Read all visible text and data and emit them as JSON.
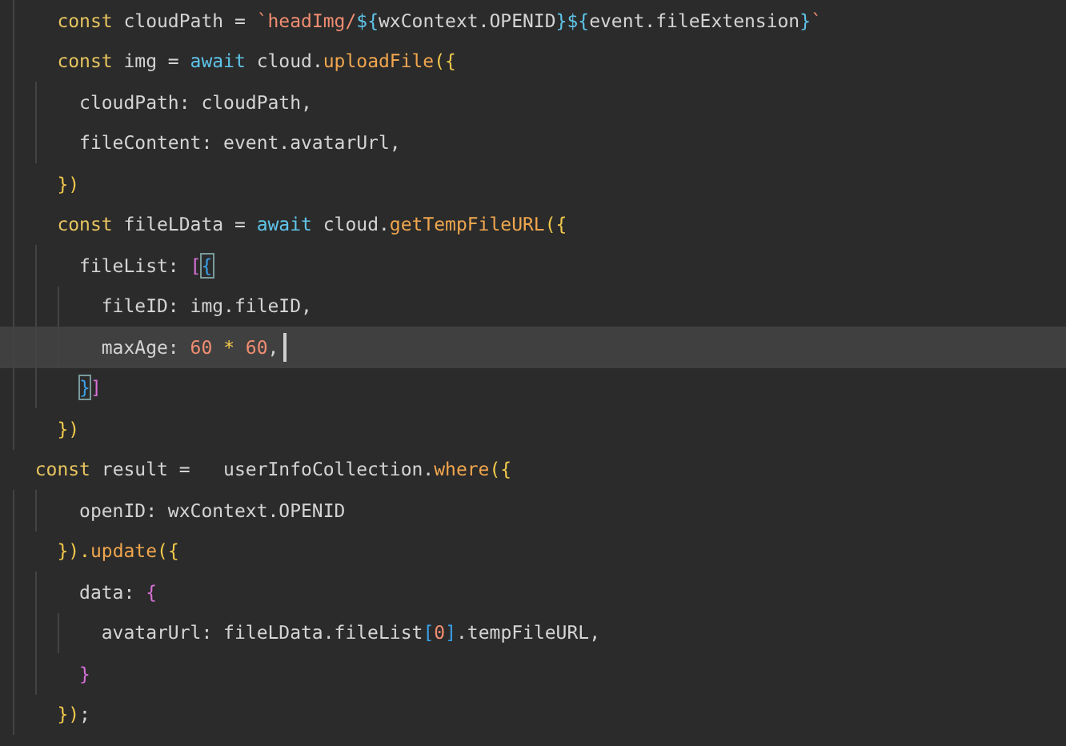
{
  "editor": {
    "lines": [
      {
        "current": false,
        "tokens": [
          {
            "text": "    const",
            "kind": "keyword"
          },
          {
            "text": " cloudPath = ",
            "kind": "plain"
          },
          {
            "text": "`headImg/",
            "kind": "string"
          },
          {
            "text": "${",
            "kind": "interp"
          },
          {
            "text": "wxContext.OPENID",
            "kind": "plain"
          },
          {
            "text": "}${",
            "kind": "interp"
          },
          {
            "text": "event.fileExtension",
            "kind": "plain"
          },
          {
            "text": "}",
            "kind": "interp"
          },
          {
            "text": "`",
            "kind": "string"
          }
        ]
      },
      {
        "current": false,
        "tokens": [
          {
            "text": "    const",
            "kind": "keyword"
          },
          {
            "text": " img = ",
            "kind": "plain"
          },
          {
            "text": "await",
            "kind": "control"
          },
          {
            "text": " cloud.",
            "kind": "plain"
          },
          {
            "text": "uploadFile",
            "kind": "func"
          },
          {
            "text": "({",
            "kind": "bracket1"
          }
        ]
      },
      {
        "current": false,
        "tokens": [
          {
            "text": "      cloudPath: cloudPath,",
            "kind": "plain"
          }
        ]
      },
      {
        "current": false,
        "tokens": [
          {
            "text": "      fileContent: event.avatarUrl,",
            "kind": "plain"
          }
        ]
      },
      {
        "current": false,
        "tokens": [
          {
            "text": "    })",
            "kind": "bracket1"
          }
        ]
      },
      {
        "current": false,
        "tokens": [
          {
            "text": "    const",
            "kind": "keyword"
          },
          {
            "text": " fileLData = ",
            "kind": "plain"
          },
          {
            "text": "await",
            "kind": "control"
          },
          {
            "text": " cloud.",
            "kind": "plain"
          },
          {
            "text": "getTempFileURL",
            "kind": "func"
          },
          {
            "text": "({",
            "kind": "bracket1"
          }
        ]
      },
      {
        "current": false,
        "tokens": [
          {
            "text": "      fileList: ",
            "kind": "plain"
          },
          {
            "text": "[",
            "kind": "bracket2"
          },
          {
            "text": "{",
            "kind": "match"
          }
        ]
      },
      {
        "current": false,
        "tokens": [
          {
            "text": "        fileID: img.fileID,",
            "kind": "plain"
          }
        ]
      },
      {
        "current": true,
        "tokens": [
          {
            "text": "        maxAge: ",
            "kind": "plain"
          },
          {
            "text": "60",
            "kind": "number"
          },
          {
            "text": " * ",
            "kind": "operator"
          },
          {
            "text": "60",
            "kind": "number"
          },
          {
            "text": ",",
            "kind": "plain"
          }
        ]
      },
      {
        "current": false,
        "tokens": [
          {
            "text": "      }",
            "kind": "match"
          },
          {
            "text": "]",
            "kind": "bracket2"
          }
        ]
      },
      {
        "current": false,
        "tokens": [
          {
            "text": "    })",
            "kind": "bracket1"
          }
        ]
      },
      {
        "current": false,
        "tokens": [
          {
            "text": "  const",
            "kind": "keyword"
          },
          {
            "text": " result =   userInfoCollection.",
            "kind": "plain"
          },
          {
            "text": "where",
            "kind": "func"
          },
          {
            "text": "({",
            "kind": "bracket1"
          }
        ]
      },
      {
        "current": false,
        "tokens": [
          {
            "text": "      openID: wxContext.OPENID",
            "kind": "plain"
          }
        ]
      },
      {
        "current": false,
        "tokens": [
          {
            "text": "    }).",
            "kind": "bracket1"
          },
          {
            "text": "update",
            "kind": "func"
          },
          {
            "text": "({",
            "kind": "bracket1"
          }
        ]
      },
      {
        "current": false,
        "tokens": [
          {
            "text": "      data: ",
            "kind": "plain"
          },
          {
            "text": "{",
            "kind": "bracket2"
          }
        ]
      },
      {
        "current": false,
        "tokens": [
          {
            "text": "        avatarUrl: fileLData.fileList",
            "kind": "plain"
          },
          {
            "text": "[",
            "kind": "bracket3"
          },
          {
            "text": "0",
            "kind": "number"
          },
          {
            "text": "]",
            "kind": "bracket3"
          },
          {
            "text": ".tempFileURL,",
            "kind": "plain"
          }
        ]
      },
      {
        "current": false,
        "tokens": [
          {
            "text": "      }",
            "kind": "bracket2"
          }
        ]
      },
      {
        "current": false,
        "tokens": [
          {
            "text": "    })",
            "kind": "bracket1"
          },
          {
            "text": ";",
            "kind": "plain"
          }
        ]
      }
    ]
  }
}
